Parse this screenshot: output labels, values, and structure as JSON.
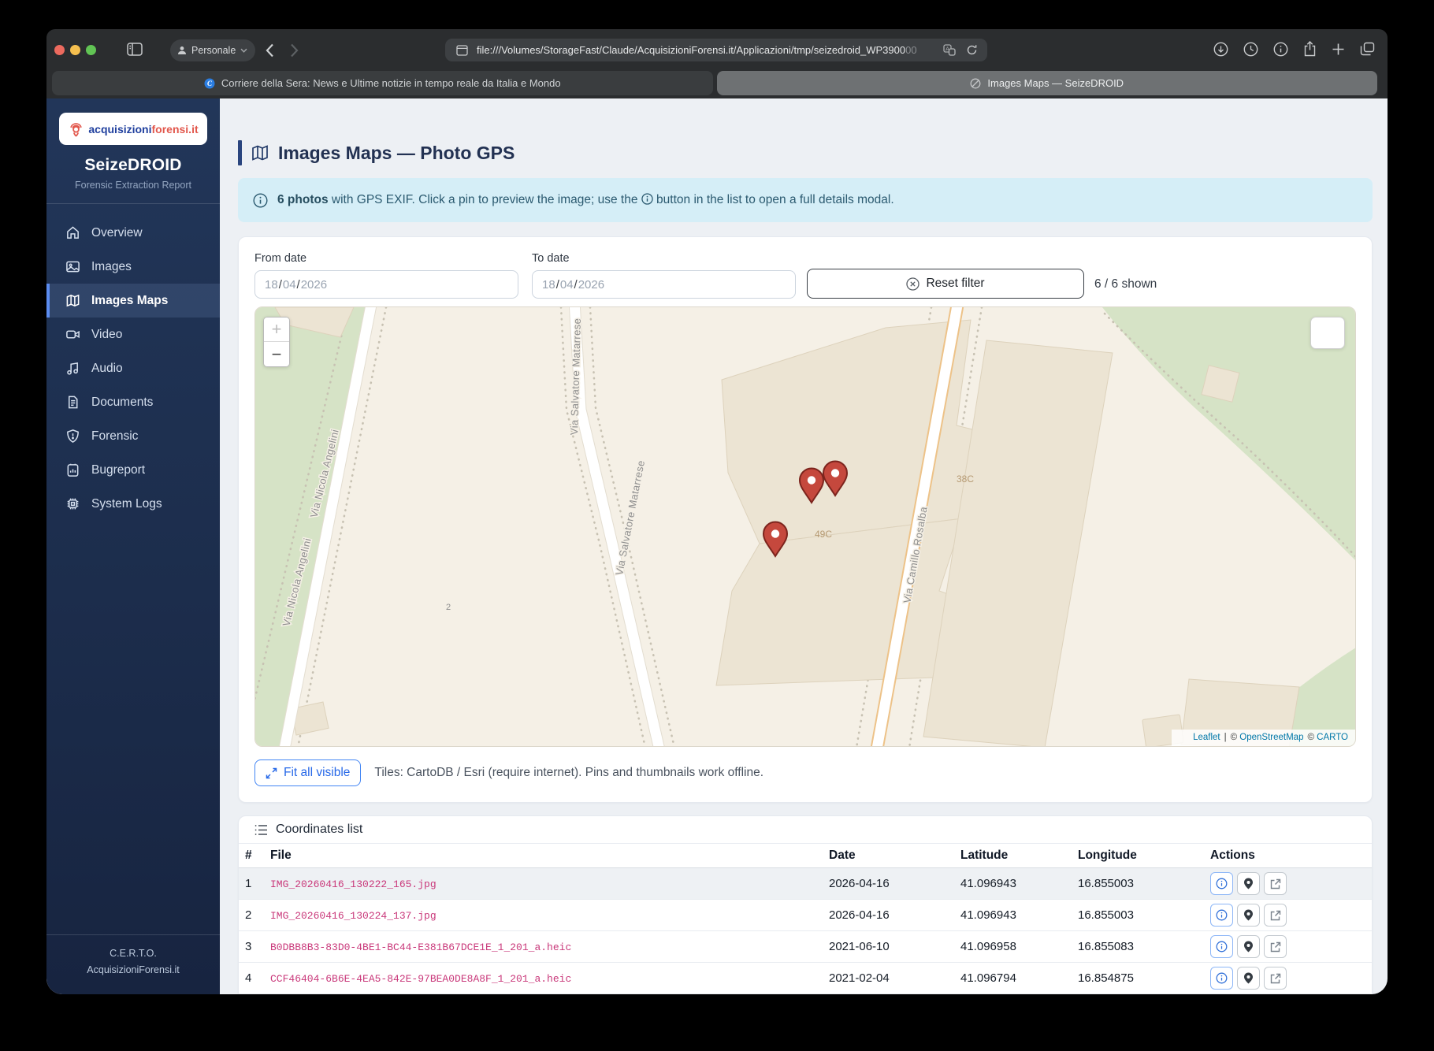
{
  "browser": {
    "profile": "Personale",
    "url": "file:///Volumes/StorageFast/Claude/AcquisizioniForensi.it/Applicazioni/tmp/seizedroid_WP3900",
    "url_tail": "00",
    "tabs": [
      {
        "title": "Corriere della Sera: News e Ultime notizie in tempo reale da Italia e Mondo"
      },
      {
        "title": "Images Maps — SeizeDROID"
      }
    ]
  },
  "sidebar": {
    "logo_blue": "acquisizioni",
    "logo_red": "forensi.it",
    "app_title": "SeizeDROID",
    "app_subtitle": "Forensic Extraction Report",
    "items": [
      {
        "label": "Overview"
      },
      {
        "label": "Images"
      },
      {
        "label": "Images Maps"
      },
      {
        "label": "Video"
      },
      {
        "label": "Audio"
      },
      {
        "label": "Documents"
      },
      {
        "label": "Forensic"
      },
      {
        "label": "Bugreport"
      },
      {
        "label": "System Logs"
      }
    ],
    "footer_line1": "C.E.R.T.O.",
    "footer_line2": "AcquisizioniForensi.it"
  },
  "page": {
    "title": "Images Maps — Photo GPS",
    "banner_bold": "6 photos",
    "banner_mid": " with GPS EXIF. Click a pin to preview the image; use the ",
    "banner_post": " button in the list to open a full details modal."
  },
  "filters": {
    "from_label": "From date",
    "to_label": "To date",
    "date_placeholder": {
      "dd": "18",
      "sep": "/",
      "mm": "04",
      "yyyy": "2026"
    },
    "reset_label": "Reset filter",
    "shown": "6 / 6 shown"
  },
  "map": {
    "zoom_in": "+",
    "zoom_out": "−",
    "streets": {
      "nicola": "Via Nicola Angelini",
      "salvatore": "Via Salvatore Matarrese",
      "camillo": "Via Camillo Rosalba"
    },
    "plots": {
      "p38": "38C",
      "p49": "49C",
      "p2": "2"
    },
    "attribution": {
      "leaflet": "Leaflet",
      "sep": "|",
      "copy_osm": "©",
      "osm": "OpenStreetMap",
      "copy_carto": "©",
      "carto": "CARTO"
    },
    "fit_button": "Fit all visible",
    "tiles_note": "Tiles: CartoDB / Esri (require internet). Pins and thumbnails work offline."
  },
  "coordinates": {
    "title": "Coordinates list",
    "headers": {
      "idx": "#",
      "file": "File",
      "date": "Date",
      "lat": "Latitude",
      "lon": "Longitude",
      "actions": "Actions"
    },
    "rows": [
      {
        "idx": "1",
        "file": "IMG_20260416_130222_165.jpg",
        "date": "2026-04-16",
        "lat": "41.096943",
        "lon": "16.855003"
      },
      {
        "idx": "2",
        "file": "IMG_20260416_130224_137.jpg",
        "date": "2026-04-16",
        "lat": "41.096943",
        "lon": "16.855003"
      },
      {
        "idx": "3",
        "file": "B0DBB8B3-83D0-4BE1-BC44-E381B67DCE1E_1_201_a.heic",
        "date": "2021-06-10",
        "lat": "41.096958",
        "lon": "16.855083"
      },
      {
        "idx": "4",
        "file": "CCF46404-6B6E-4EA5-842E-97BEA0DE8A8F_1_201_a.heic",
        "date": "2021-02-04",
        "lat": "41.096794",
        "lon": "16.854875"
      }
    ]
  }
}
